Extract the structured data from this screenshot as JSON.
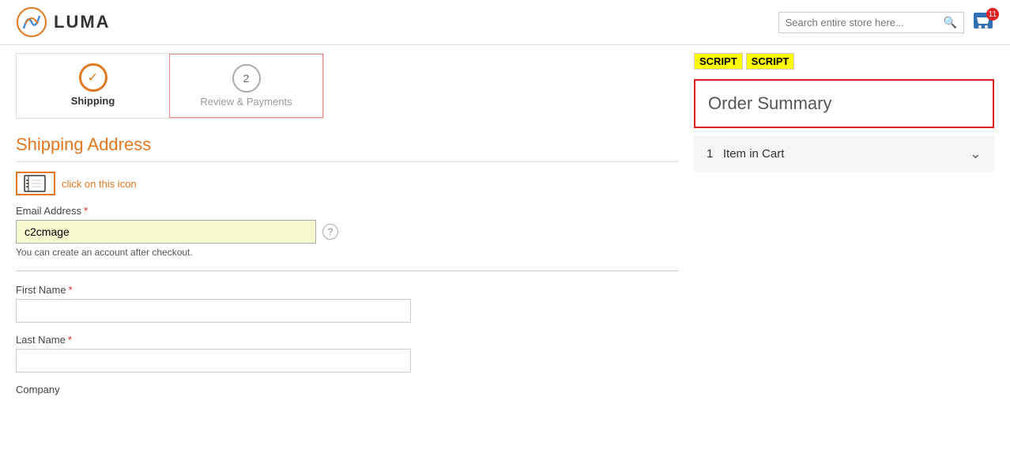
{
  "header": {
    "logo_text": "LUMA",
    "search_placeholder": "Search entire store here...",
    "cart_count": "11"
  },
  "steps": [
    {
      "number": "✓",
      "label": "Shipping",
      "active": true
    },
    {
      "number": "2",
      "label": "Review & Payments",
      "active": false
    }
  ],
  "shipping": {
    "title": "Shipping Address",
    "click_label": "click on this icon",
    "email_label": "Email Address",
    "email_value": "c2cmage",
    "account_hint": "You can create an account after checkout.",
    "first_name_label": "First Name",
    "last_name_label": "Last Name",
    "company_label": "Company"
  },
  "order_summary": {
    "title": "Order Summary",
    "cart_line": "1 Item in Cart",
    "cart_num": "1",
    "cart_text": "Item in Cart"
  },
  "script_badges": [
    "SCRIPT",
    "SCRIPT"
  ]
}
